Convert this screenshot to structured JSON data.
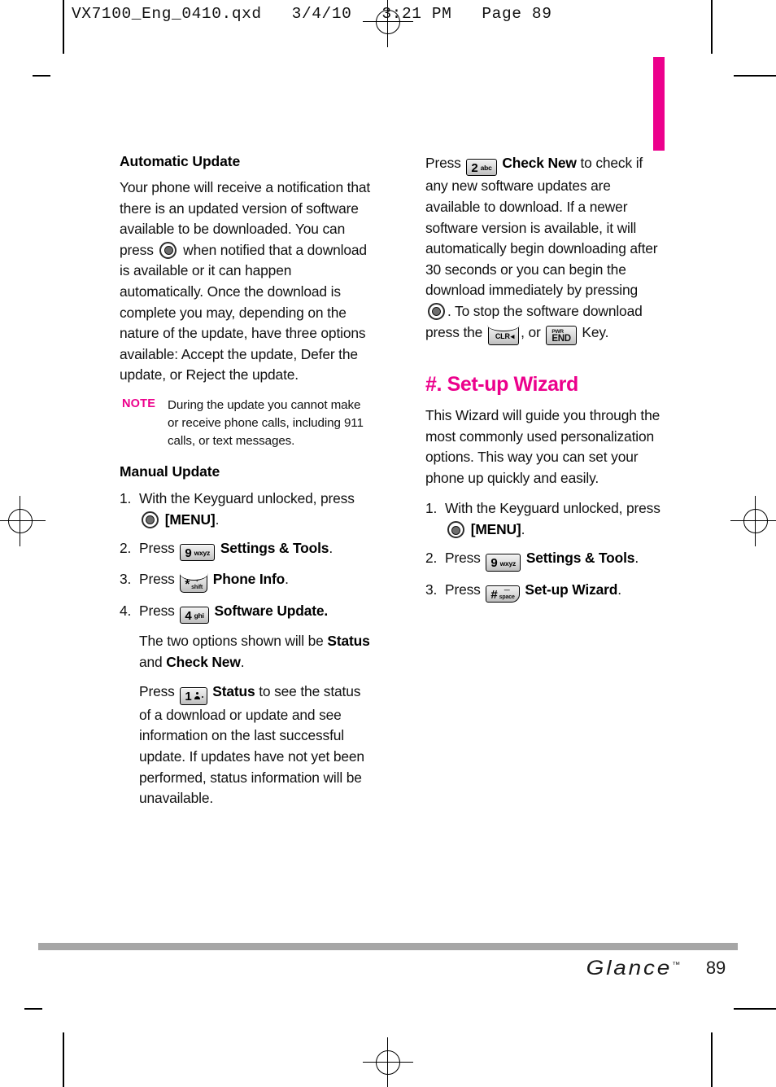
{
  "prepress_header": "VX7100_Eng_0410.qxd   3/4/10   3:21 PM   Page 89",
  "accent_color": "#ec008c",
  "left_column": {
    "heading_automatic_update": "Automatic Update",
    "paragraph_auto_1a": "Your phone will receive a notification that there is an updated version of software available to be downloaded. You can press",
    "paragraph_auto_1b": "when notified that a download is available or it can happen automatically. Once the download is complete you may, depending on the nature of the update, have three options available: Accept the update, Defer the update, or Reject the update.",
    "note_label": "NOTE",
    "note_text": "During the update you cannot make or receive phone calls, including 911 calls, or text messages.",
    "heading_manual_update": "Manual Update",
    "steps": [
      {
        "number": "1.",
        "text_before": "With the Keyguard unlocked, press",
        "key": "ok-key",
        "text_after": "[MENU].",
        "bold_after": "[MENU]"
      },
      {
        "number": "2.",
        "text_before": "Press",
        "key_digit": "9",
        "key_label": "wxyz",
        "bold_after": "Settings & Tools",
        "punct": "."
      },
      {
        "number": "3.",
        "text_before": "Press",
        "key_digit": "*",
        "key_label": "shift",
        "bold_after": "Phone Info",
        "punct": "."
      },
      {
        "number": "4.",
        "text_before": "Press",
        "key_digit": "4",
        "key_label": "ghi",
        "bold_after": "Software Update.",
        "punct": ""
      }
    ],
    "sub_para_1_pre": "The two options shown will be",
    "sub_para_1_bold_a": "Status",
    "sub_para_1_mid": "and",
    "sub_para_1_bold_b": "Check New",
    "sub_para_1_end": ".",
    "sub_para_2_pre": "Press",
    "sub_para_2_key_digit": "1",
    "sub_para_2_bold": "Status",
    "sub_para_2_post": "to see the status of a download or update and see information on the last successful update. If updates have not yet been performed, status information will be unavailable."
  },
  "right_column": {
    "paragraph_check_new_pre": "Press",
    "check_new_key_digit": "2",
    "check_new_key_label": "abc",
    "check_new_bold": "Check New",
    "paragraph_check_new_mid": "to check if any new software updates are available to download. If a newer software version is available, it will automatically begin downloading after 30 seconds or you can begin the download immediately by pressing",
    "paragraph_check_new_after_ok": ". To stop the software download press the",
    "clr_key_label": "CLR",
    "paragraph_between_keys": ", or",
    "end_key_top": "PWR",
    "end_key_bottom": "END",
    "paragraph_check_new_tail": "Key.",
    "heading_setup_wizard": "#. Set-up Wizard",
    "paragraph_wizard": "This Wizard will guide you through the most commonly used personalization options. This way you can set your phone up quickly and easily.",
    "steps": [
      {
        "number": "1.",
        "text_before": "With the Keyguard unlocked, press",
        "key": "ok-key",
        "bold_after": "[MENU]",
        "punct": "."
      },
      {
        "number": "2.",
        "text_before": "Press",
        "key_digit": "9",
        "key_label": "wxyz",
        "bold_after": "Settings & Tools",
        "punct": "."
      },
      {
        "number": "3.",
        "text_before": "Press",
        "key_digit": "#",
        "key_label": "space",
        "bold_after": "Set-up Wizard",
        "punct": "."
      }
    ]
  },
  "footer": {
    "brand": "Glance",
    "trademark": "™",
    "page_number": "89"
  }
}
